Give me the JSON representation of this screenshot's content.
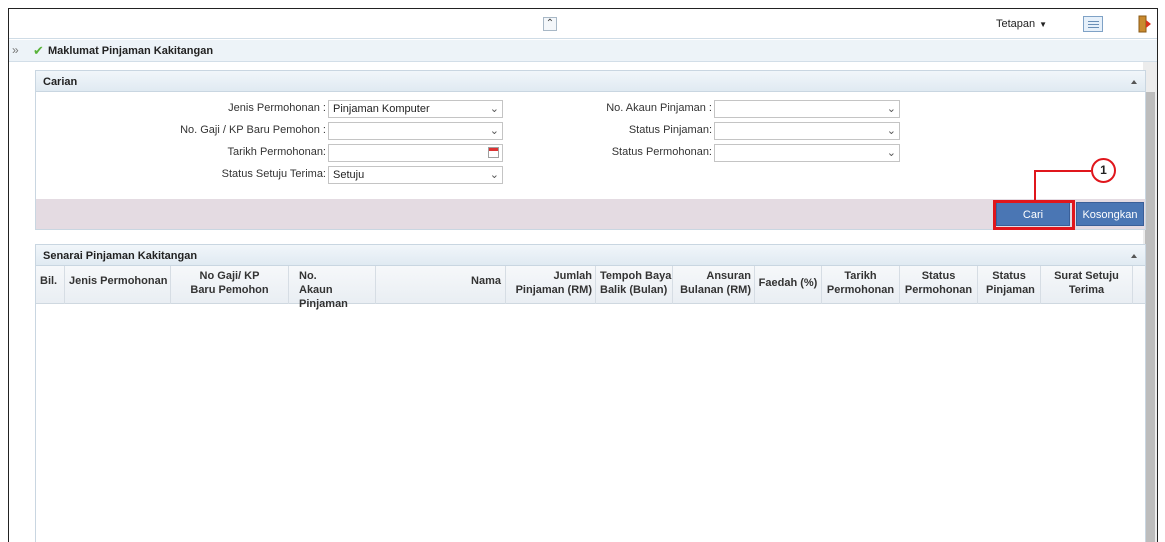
{
  "topbar": {
    "collapse_glyph": "»",
    "settings_label": "Tetapan",
    "icons": [
      "collapse-up-icon",
      "caret-down-icon",
      "list-view-icon",
      "logout-icon"
    ]
  },
  "page": {
    "title": "Maklumat Pinjaman Kakitangan",
    "expand_glyph": "»",
    "check_glyph": "✔"
  },
  "search": {
    "title": "Carian",
    "fields": {
      "jenis_permohonan": {
        "label": "Jenis Permohonan :",
        "value": "Pinjaman Komputer"
      },
      "no_gaji": {
        "label": "No. Gaji / KP Baru Pemohon :",
        "value": ""
      },
      "tarikh_permohonan": {
        "label": "Tarikh Permohonan:",
        "value": ""
      },
      "status_setuju_terima": {
        "label": "Status Setuju Terima:",
        "value": "Setuju"
      },
      "no_akaun": {
        "label": "No. Akaun Pinjaman :",
        "value": ""
      },
      "status_pinjaman": {
        "label": "Status Pinjaman:",
        "value": ""
      },
      "status_permohonan": {
        "label": "Status Permohonan:",
        "value": ""
      }
    },
    "buttons": {
      "search": "Cari",
      "clear": "Kosongkan"
    },
    "callout": "1"
  },
  "list": {
    "title": "Senarai Pinjaman Kakitangan",
    "columns": [
      "Bil.",
      "Jenis Permohonan",
      "No Gaji/ KP Baru Pemohon",
      "No. Akaun Pinjaman",
      "Nama",
      "Jumlah Pinjaman (RM)",
      "Tempoh Baya Balik (Bulan)",
      "Ansuran Bulanan (RM)",
      "Faedah (%)",
      "Tarikh Permohonan",
      "Status Permohonan",
      "Status Pinjaman",
      "Surat Setuju Terima"
    ],
    "rows": []
  },
  "colors": {
    "accent_button": "#4a76b4",
    "highlight": "#e0161c",
    "action_bar": "#e4dbe2"
  }
}
